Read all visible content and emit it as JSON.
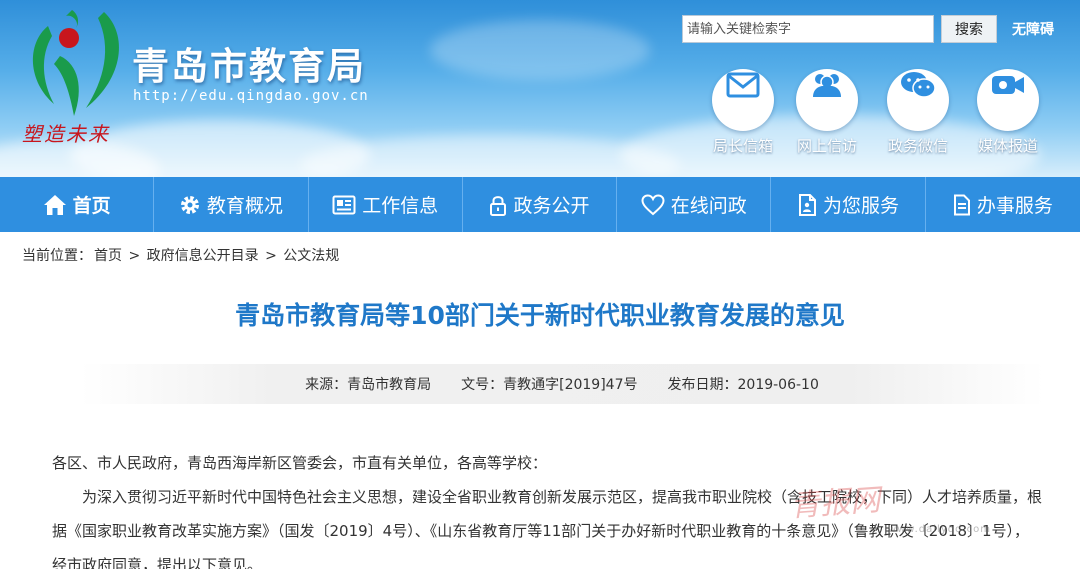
{
  "header": {
    "site_title": "青岛市教育局",
    "site_url": "http://edu.qingdao.gov.cn",
    "logo_motto": "塑造未来",
    "search": {
      "placeholder": "请输入关键检索字",
      "button_label": "搜索"
    },
    "accessibility_label": "无障碍",
    "quick_links": [
      {
        "label": "局长信箱",
        "icon": "mail-icon"
      },
      {
        "label": "网上信访",
        "icon": "people-icon"
      },
      {
        "label": "政务微信",
        "icon": "wechat-icon"
      },
      {
        "label": "媒体报道",
        "icon": "video-camera-icon"
      }
    ]
  },
  "nav": [
    {
      "label": "首页",
      "icon": "home-icon"
    },
    {
      "label": "教育概况",
      "icon": "gear-icon"
    },
    {
      "label": "工作信息",
      "icon": "news-icon"
    },
    {
      "label": "政务公开",
      "icon": "lock-icon"
    },
    {
      "label": "在线问政",
      "icon": "heart-icon"
    },
    {
      "label": "为您服务",
      "icon": "service-icon"
    },
    {
      "label": "办事服务",
      "icon": "document-icon"
    }
  ],
  "breadcrumb": {
    "prefix": "当前位置：",
    "items": [
      "首页",
      "政府信息公开目录",
      "公文法规"
    ],
    "separator": ">"
  },
  "article": {
    "title": "青岛市教育局等10部门关于新时代职业教育发展的意见",
    "meta": {
      "source": "来源：青岛市教育局",
      "doc_number": "文号：青教通字[2019]47号",
      "publish_date": "发布日期：2019-06-10"
    },
    "salutation": "各区、市人民政府，青岛西海岸新区管委会，市直有关单位，各高等学校：",
    "paragraph_1": "为深入贯彻习近平新时代中国特色社会主义思想，建设全省职业教育创新发展示范区，提高我市职业院校（含技工院校，下同）人才培养质量，根据《国家职业教育改革实施方案》（国发〔2019〕4号）、《山东省教育厅等11部门关于办好新时代职业教育的十条意见》（鲁教职发〔2018〕1号），经市政府同意，提出以下意见。"
  },
  "watermark": {
    "text": "青报网",
    "url": "www.dailyqd.com"
  },
  "colors": {
    "nav_bg": "#2f8fe0",
    "title_blue": "#1f78c8",
    "logo_red": "#c8161d",
    "logo_green": "#1a9b4b"
  }
}
